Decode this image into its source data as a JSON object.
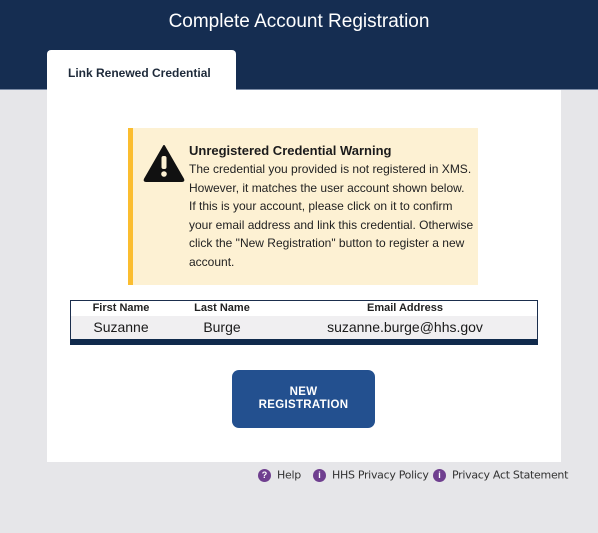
{
  "header": {
    "title": "Complete Account Registration"
  },
  "tabs": [
    {
      "label": "Link Renewed Credential",
      "active": true
    }
  ],
  "warning": {
    "icon": "warning-triangle-icon",
    "title": "Unregistered Credential Warning",
    "text": "The credential you provided is not registered in XMS. However, it matches the user account shown below. If this is your account, please click on it to confirm your email address and link this credential. Otherwise click the \"New Registration\" button to register a new account.",
    "accent_color": "#fbbd2f",
    "background_color": "#fdf1d3"
  },
  "table": {
    "columns": [
      "First Name",
      "Last Name",
      "Email Address"
    ],
    "rows": [
      [
        "Suzanne",
        "Burge",
        "suzanne.burge@hhs.gov"
      ]
    ]
  },
  "new_registration_button": {
    "line1": "NEW",
    "line2": "REGISTRATION",
    "color": "#23508f"
  },
  "footer": {
    "links": [
      {
        "icon": "help-icon",
        "glyph": "?",
        "label": "Help"
      },
      {
        "icon": "info-icon",
        "glyph": "i",
        "label": "HHS Privacy Policy"
      },
      {
        "icon": "info-icon",
        "glyph": "i",
        "label": "Privacy Act Statement"
      }
    ],
    "icon_color": "#6f3f8f"
  },
  "colors": {
    "header_bg": "#152d51",
    "page_bg": "#e6e6e9"
  }
}
